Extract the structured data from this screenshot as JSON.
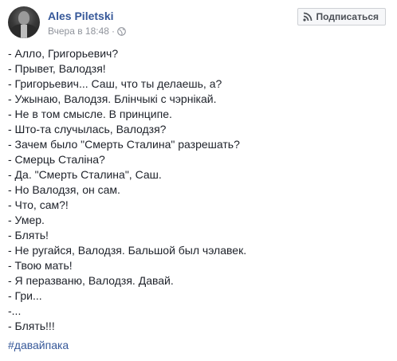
{
  "post": {
    "author": "Ales Piletski",
    "timestamp": "Вчера в 18:48",
    "separator": "·",
    "privacy_icon": "globe-icon",
    "subscribe_label": "Подписаться",
    "subscribe_icon": "rss-icon",
    "lines": [
      "- Алло, Григорьевич?",
      "- Прывет, Валодзя!",
      "- Григорьевич... Саш, что ты делаешь, а?",
      "- Ужынаю, Валодзя. Блінчыкі с чэрнікай.",
      "- Не в том смысле. В принципе.",
      "- Што-та случылась, Валодзя?",
      "- Зачем было \"Смерть Сталина\" разрешать?",
      "- Смерць Сталіна?",
      "- Да. \"Смерть Сталина\", Саш.",
      "- Но Валодзя, он сам.",
      "- Что, сам?!",
      "- Умер.",
      "- Блять!",
      "- Не ругайся, Валодзя. Бальшой был чэлавек.",
      "- Твою мать!",
      "- Я перазваню, Валодзя. Давай.",
      "- Гри...",
      "-...",
      "- Блять!!!"
    ],
    "hashtag": "#давайпака"
  },
  "colors": {
    "link": "#365899",
    "text": "#1d2129",
    "muted": "#90949c",
    "button_bg": "#f6f7f9",
    "button_border": "#ced0d4"
  }
}
